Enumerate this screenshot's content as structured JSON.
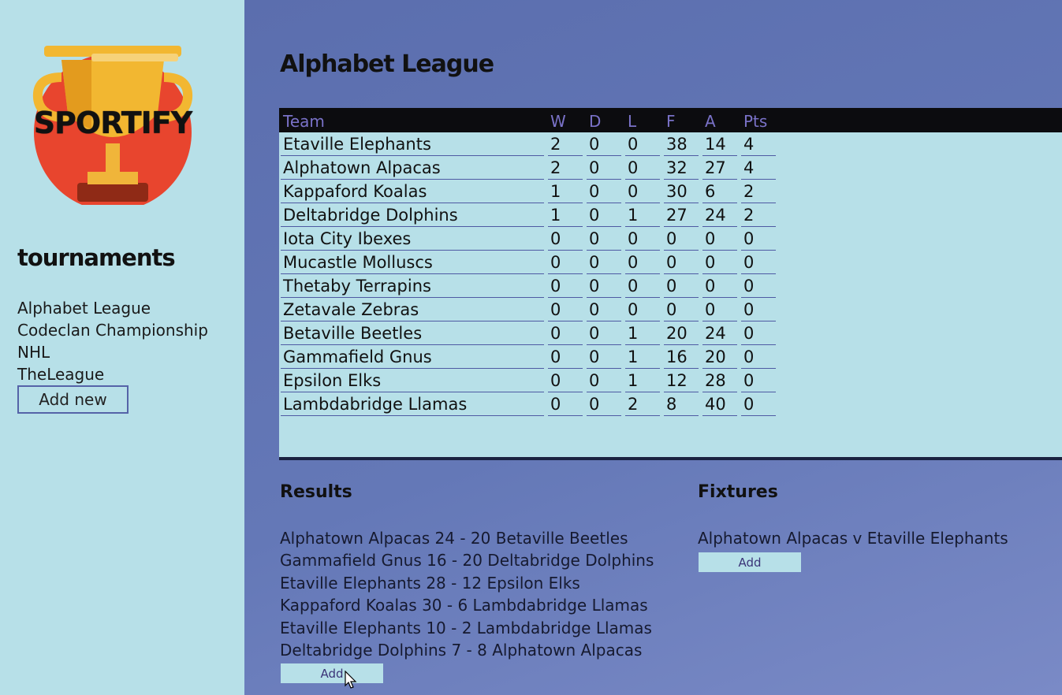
{
  "sidebar": {
    "logo_text": "SPORTIFY",
    "heading": "tournaments",
    "tournaments": [
      "Alphabet League",
      "Codeclan Championship",
      "NHL",
      "TheLeague"
    ],
    "add_new_label": "Add new"
  },
  "main": {
    "title": "Alphabet League",
    "table": {
      "headers": [
        "Team",
        "W",
        "D",
        "L",
        "F",
        "A",
        "Pts"
      ],
      "rows": [
        [
          "Etaville Elephants",
          "2",
          "0",
          "0",
          "38",
          "14",
          "4"
        ],
        [
          "Alphatown Alpacas",
          "2",
          "0",
          "0",
          "32",
          "27",
          "4"
        ],
        [
          "Kappaford Koalas",
          "1",
          "0",
          "0",
          "30",
          "6",
          "2"
        ],
        [
          "Deltabridge Dolphins",
          "1",
          "0",
          "1",
          "27",
          "24",
          "2"
        ],
        [
          "Iota City Ibexes",
          "0",
          "0",
          "0",
          "0",
          "0",
          "0"
        ],
        [
          "Mucastle Molluscs",
          "0",
          "0",
          "0",
          "0",
          "0",
          "0"
        ],
        [
          "Thetaby Terrapins",
          "0",
          "0",
          "0",
          "0",
          "0",
          "0"
        ],
        [
          "Zetavale Zebras",
          "0",
          "0",
          "0",
          "0",
          "0",
          "0"
        ],
        [
          "Betaville Beetles",
          "0",
          "0",
          "1",
          "20",
          "24",
          "0"
        ],
        [
          "Gammafield Gnus",
          "0",
          "0",
          "1",
          "16",
          "20",
          "0"
        ],
        [
          "Epsilon Elks",
          "0",
          "0",
          "1",
          "12",
          "28",
          "0"
        ],
        [
          "Lambdabridge Llamas",
          "0",
          "0",
          "2",
          "8",
          "40",
          "0"
        ]
      ]
    },
    "results": {
      "heading": "Results",
      "items": [
        "Alphatown Alpacas 24 - 20 Betaville Beetles",
        "Gammafield Gnus 16 - 20 Deltabridge Dolphins",
        "Etaville Elephants 28 - 12 Epsilon Elks",
        "Kappaford Koalas 30 - 6 Lambdabridge Llamas",
        "Etaville Elephants 10 - 2 Lambdabridge Llamas",
        "Deltabridge Dolphins 7 - 8 Alphatown Alpacas"
      ],
      "add_label": "Add"
    },
    "fixtures": {
      "heading": "Fixtures",
      "items": [
        "Alphatown Alpacas v Etaville Elephants"
      ],
      "add_label": "Add"
    }
  },
  "colors": {
    "sidebar_bg": "#b7e0e8",
    "main_bg": "#5b6eae",
    "header_bar": "#0c0c0f",
    "header_text": "#7a72c8"
  }
}
